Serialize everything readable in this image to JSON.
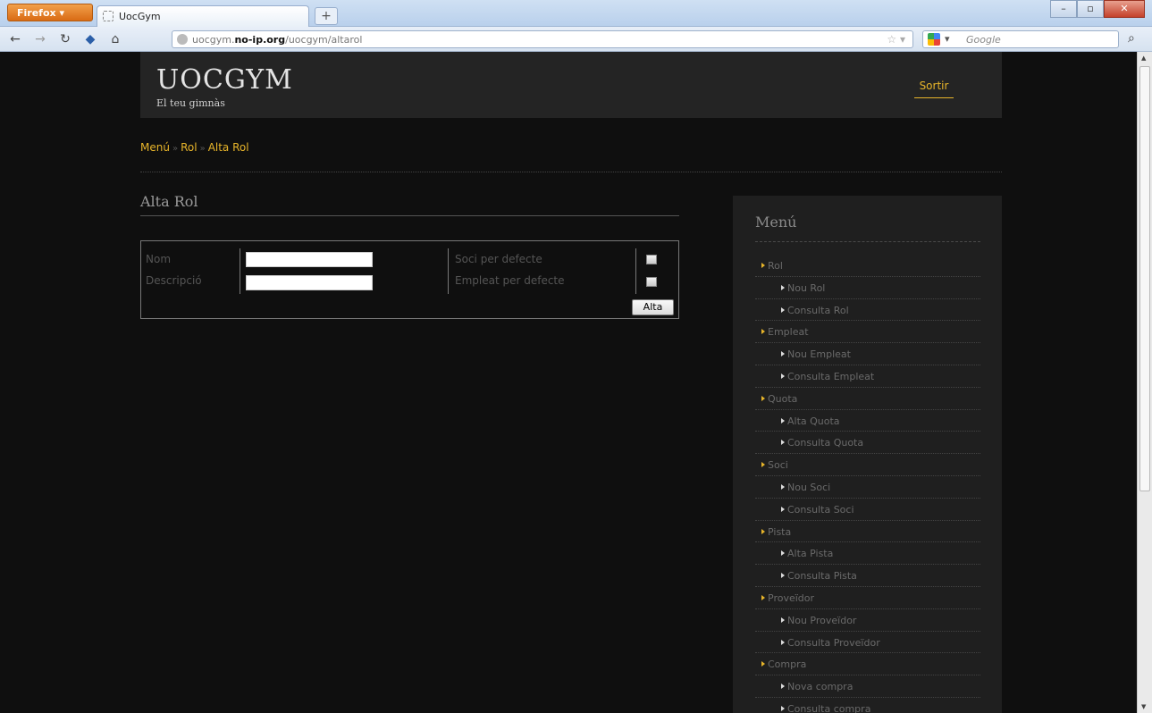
{
  "browser": {
    "menu_button": "Firefox ▾",
    "tab_title": "UocGym",
    "new_tab": "+",
    "url_host_prefix": "uocgym.",
    "url_host_bold": "no-ip.org",
    "url_path": "/uocgym/altarol",
    "search_placeholder": "Google",
    "window_controls": {
      "minimize": "–",
      "maximize": "▫",
      "close": "✕"
    }
  },
  "header": {
    "logo": "UOCGYM",
    "tagline": "El teu gimnàs",
    "logout": "Sortir"
  },
  "breadcrumb": {
    "item1": "Menú",
    "item2": "Rol",
    "item3": "Alta Rol",
    "separator": "»"
  },
  "form": {
    "title": "Alta Rol",
    "nom_label": "Nom",
    "descripcio_label": "Descripció",
    "soci_label": "Soci per defecte",
    "empleat_label": "Empleat per defecte",
    "nom_value": "",
    "descripcio_value": "",
    "submit_label": "Alta"
  },
  "sidebar": {
    "title": "Menú",
    "items": [
      {
        "label": "Rol",
        "level": 1
      },
      {
        "label": "Nou Rol",
        "level": 2
      },
      {
        "label": "Consulta Rol",
        "level": 2
      },
      {
        "label": "Empleat",
        "level": 1
      },
      {
        "label": "Nou Empleat",
        "level": 2
      },
      {
        "label": "Consulta Empleat",
        "level": 2
      },
      {
        "label": "Quota",
        "level": 1
      },
      {
        "label": "Alta Quota",
        "level": 2
      },
      {
        "label": "Consulta Quota",
        "level": 2
      },
      {
        "label": "Soci",
        "level": 1
      },
      {
        "label": "Nou Soci",
        "level": 2
      },
      {
        "label": "Consulta Soci",
        "level": 2
      },
      {
        "label": "Pista",
        "level": 1
      },
      {
        "label": "Alta Pista",
        "level": 2
      },
      {
        "label": "Consulta Pista",
        "level": 2
      },
      {
        "label": "Proveïdor",
        "level": 1
      },
      {
        "label": "Nou Proveïdor",
        "level": 2
      },
      {
        "label": "Consulta Proveïdor",
        "level": 2
      },
      {
        "label": "Compra",
        "level": 1
      },
      {
        "label": "Nova compra",
        "level": 2
      },
      {
        "label": "Consulta compra",
        "level": 2
      }
    ]
  },
  "colors": {
    "accent": "#e8b52a",
    "background": "#0f0f0f",
    "panel": "#242424"
  }
}
